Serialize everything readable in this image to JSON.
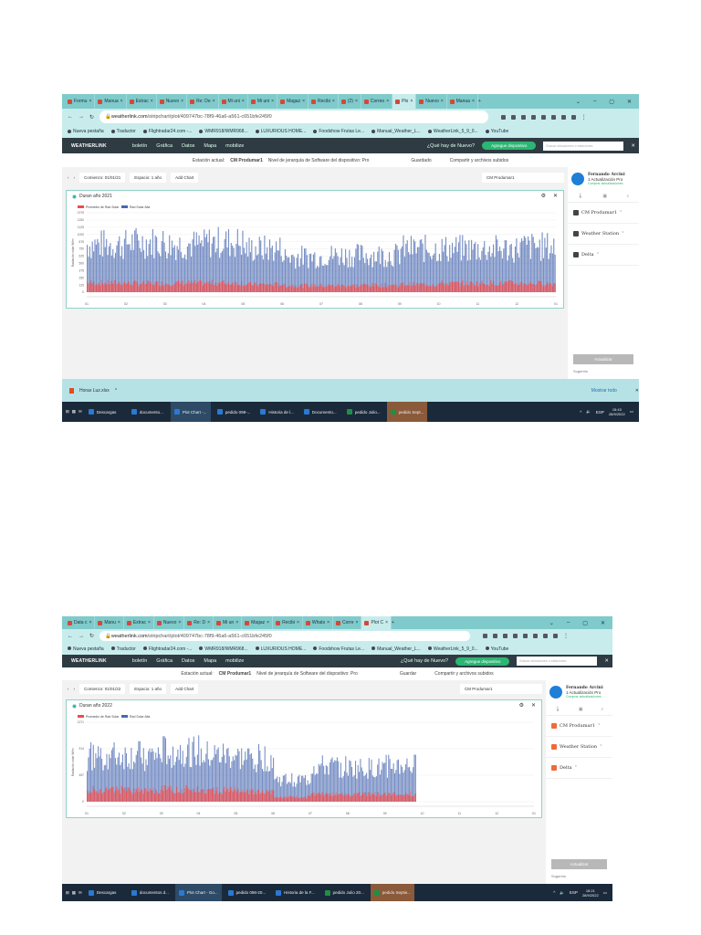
{
  "shots": [
    {
      "tabs": [
        "Formu",
        "Manua",
        "Extrac",
        "Nuevo",
        "Re: De",
        "Mi uni",
        "Mi uni",
        "Magaz",
        "Recibi",
        "(2)",
        "Correo",
        "Plo",
        "Nuevo",
        "Manua"
      ],
      "active_tab": 11,
      "url_domain": "weatherlink.com",
      "url_path": "/stripchart/plot/409747bc-78f9-46a6-a561-c651bfe245f0",
      "bookmarks": [
        "Nueva pestaña",
        "Traductor",
        "Flightradar24.com -...",
        "WMR918/WMR968...",
        "LUXURIOUS HOME...",
        "Foodshow Frutas Le...",
        "Manual_Weather_L...",
        "WeatherLink_5_9_0...",
        "YouTube"
      ],
      "nav": {
        "logo": "WEATHERLINK",
        "items": [
          "boletín",
          "Gráfica",
          "Datos",
          "Mapa",
          "mobilize"
        ],
        "whats_new": "¿Qué hay de Nuevo?",
        "add_device": "Agregue dispositivo",
        "search_placeholder": "Buscar ubicaciones o estaciones"
      },
      "station": {
        "label": "Estación actual:",
        "name": "CM Produmar1",
        "tier": "Nivel de jerarquía de Software del dispositivo: Pro",
        "save": "Guardado",
        "share": "Compartir y archivos subidos"
      },
      "toolbar": {
        "start": "Comienzo: 01/01/21",
        "span": "Espacio: 1 año",
        "add_chart": "Add Chart",
        "station_select": "CM Produmar1"
      },
      "user": {
        "name": "Fernando Arcini",
        "plan": "1 Actualización Pro",
        "buy": "Comprar actualizaciones"
      },
      "side_items": [
        "CM Produmar1",
        "Weather Station",
        "Delta"
      ],
      "side_icon_color": "#444444",
      "update_btn": "Actualizar",
      "suggest": "Sugerirlo",
      "download": {
        "file": "Horas Luz.xlsx",
        "show_all": "Mostrar todo"
      },
      "taskbar": {
        "items": [
          "Descargas",
          "documento...",
          "Plot Chart -...",
          "pedido 098-...",
          "Historia de l...",
          "Documento...",
          "pedido Julio...",
          "pedido Sept..."
        ],
        "lang": "ESP",
        "time": "15:43",
        "date": "28/9/2022"
      },
      "chart_data": {
        "type": "bar",
        "title": "Duran año 2021",
        "ylabel": "Radiación solar W/m²",
        "legend": [
          {
            "name": "Promedio de Rad Solar",
            "color": "#ef4b4b"
          },
          {
            "name": "Rad Solar Alta",
            "color": "#4a68b0"
          }
        ],
        "yticks": [
          0,
          125,
          250,
          375,
          500,
          625,
          750,
          875,
          1000,
          1125,
          1250,
          1375
        ],
        "ylim": [
          0,
          1375
        ],
        "xticks": [
          "01",
          "02",
          "03",
          "04",
          "05",
          "06",
          "07",
          "08",
          "09",
          "10",
          "11",
          "12",
          "01"
        ],
        "monthly_high": [
          1100,
          1150,
          1100,
          1150,
          1000,
          820,
          850,
          860,
          1000,
          1000,
          1000,
          1050
        ],
        "monthly_avg": [
          180,
          170,
          175,
          180,
          150,
          130,
          125,
          135,
          150,
          170,
          175,
          170
        ]
      }
    },
    {
      "tabs": [
        "Data c",
        "Manu",
        "Extrac",
        "Nuevo",
        "Re: D",
        "Mi un",
        "Magaz",
        "Recibi",
        "Whats",
        "Corre",
        "Plot C"
      ],
      "active_tab": 10,
      "url_domain": "weatherlink.com",
      "url_path": "/stripchart/plot/409747bc-78f9-46a6-a561-c651bfe245f0",
      "bookmarks": [
        "Nueva pestaña",
        "Traductor",
        "Flightradar24.com -...",
        "WMR918/WMR968...",
        "LUXURIOUS HOME...",
        "Foodshow Frutas Le...",
        "Manual_Weather_L...",
        "WeatherLink_5_9_0...",
        "YouTube"
      ],
      "nav": {
        "logo": "WEATHERLINK",
        "items": [
          "boletín",
          "Gráfica",
          "Datos",
          "Mapa",
          "mobilize"
        ],
        "whats_new": "¿Qué hay de Nuevo?",
        "add_device": "Agregue dispositivo",
        "search_placeholder": "Buscar ubicaciones o estaciones"
      },
      "station": {
        "label": "Estación actual:",
        "name": "CM Produmar1",
        "tier": "Nivel de jerarquía de Software del dispositivo: Pro",
        "save": "Guardar",
        "share": "Compartir y archivos subidos"
      },
      "toolbar": {
        "start": "Comienzo: 01/01/22",
        "span": "Espacio: 1 año",
        "add_chart": "Add Chart",
        "station_select": "CM Produmar1"
      },
      "user": {
        "name": "Fernando Arcini",
        "plan": "1 Actualización Pro",
        "buy": "Comprar actualizaciones"
      },
      "side_items": [
        "CM Produmar1",
        "Weather Station",
        "Delta"
      ],
      "side_icon_color": "#f06a3a",
      "update_btn": "Actualizar",
      "suggest": "Sugerirlo",
      "taskbar": {
        "items": [
          "Descargas",
          "documentos d...",
          "Plot Chart - Go...",
          "pedido 098-20...",
          "Historia de la F...",
          "pedido Julio 20...",
          "pedido Septie..."
        ],
        "lang": "ESP",
        "time": "15:21",
        "date": "28/9/2022"
      },
      "chart_data": {
        "type": "bar",
        "title": "Duran año 2022",
        "ylabel": "Radiación solar W/m²",
        "legend": [
          {
            "name": "Promedio de Rad Solar",
            "color": "#ef4b4b"
          },
          {
            "name": "Rad Solar Alta",
            "color": "#4a68b0"
          }
        ],
        "yticks": [
          0,
          457,
          914,
          1371
        ],
        "ylim": [
          0,
          1371
        ],
        "xticks": [
          "01",
          "02",
          "03",
          "04",
          "05",
          "06",
          "07",
          "08",
          "09",
          "10",
          "11",
          "12",
          "01"
        ],
        "monthly_high": [
          1050,
          1050,
          1150,
          1050,
          1000,
          500,
          800,
          760,
          820,
          null,
          null,
          null
        ],
        "monthly_avg": [
          230,
          210,
          240,
          220,
          190,
          90,
          140,
          145,
          150,
          null,
          null,
          null
        ]
      }
    }
  ]
}
